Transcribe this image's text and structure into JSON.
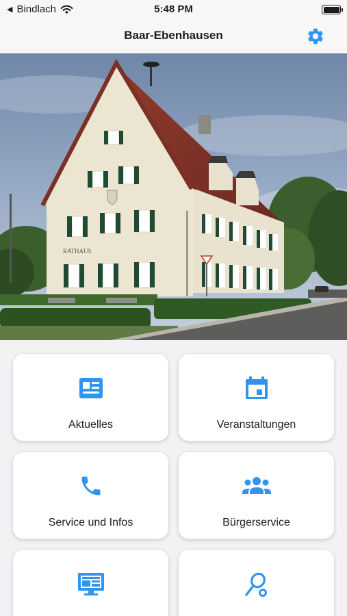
{
  "status_bar": {
    "back_app": "Bindlach",
    "time": "5:48 PM"
  },
  "nav": {
    "title": "Baar-Ebenhausen",
    "settings_icon": "gear-icon"
  },
  "hero": {
    "sign_text": "RATHAUS"
  },
  "colors": {
    "accent": "#2f95f0",
    "background": "#f2f2f5"
  },
  "tiles": [
    {
      "label": "Aktuelles",
      "icon": "newspaper-icon"
    },
    {
      "label": "Veranstaltungen",
      "icon": "calendar-icon"
    },
    {
      "label": "Service und Infos",
      "icon": "phone-icon"
    },
    {
      "label": "Bürgerservice",
      "icon": "group-icon"
    },
    {
      "label": "",
      "icon": "monitor-icon"
    },
    {
      "label": "",
      "icon": "tennis-racket-icon"
    }
  ]
}
